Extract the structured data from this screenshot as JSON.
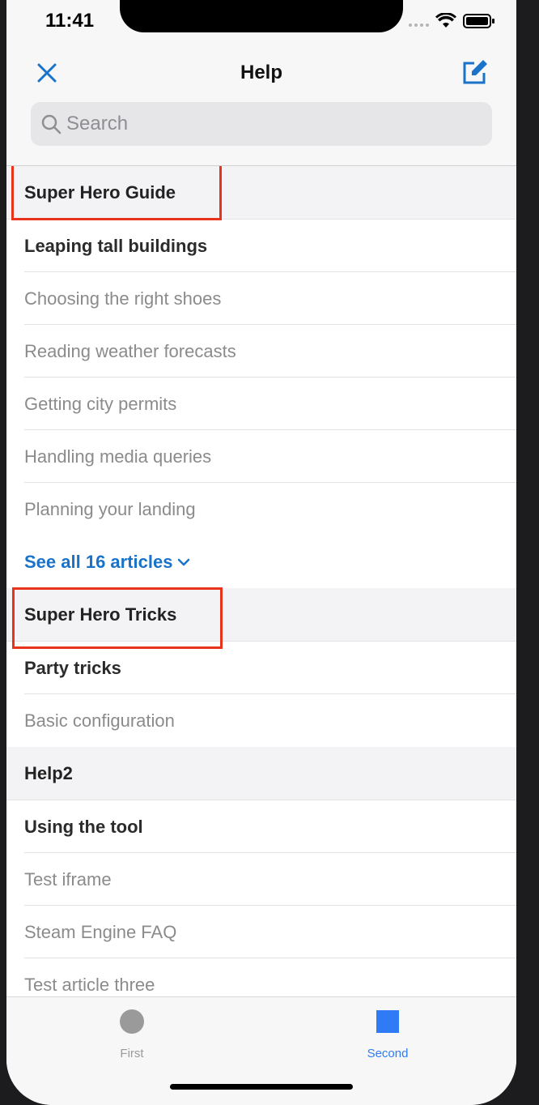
{
  "status": {
    "time": "11:41"
  },
  "header": {
    "title": "Help",
    "close_icon": "close-icon",
    "compose_icon": "compose-icon"
  },
  "search": {
    "placeholder": "Search",
    "value": ""
  },
  "sections": [
    {
      "title": "Super Hero Guide",
      "items": [
        "Leaping tall buildings",
        "Choosing the right shoes",
        "Reading weather forecasts",
        "Getting city permits",
        "Handling media queries",
        "Planning your landing"
      ],
      "see_all": "See all 16 articles"
    },
    {
      "title": "Super Hero Tricks",
      "items": [
        "Party tricks",
        "Basic configuration"
      ]
    },
    {
      "title": "Help2",
      "items": [
        "Using the tool",
        "Test iframe",
        "Steam Engine FAQ",
        "Test article three"
      ]
    }
  ],
  "tabs": [
    {
      "label": "First",
      "icon": "circle-icon",
      "active": false
    },
    {
      "label": "Second",
      "icon": "square-icon",
      "active": true
    }
  ],
  "colors": {
    "accent": "#1a73c8",
    "highlight": "#e8341c",
    "tab_active": "#2f7bf5",
    "tab_inactive": "#9a9a9a"
  }
}
